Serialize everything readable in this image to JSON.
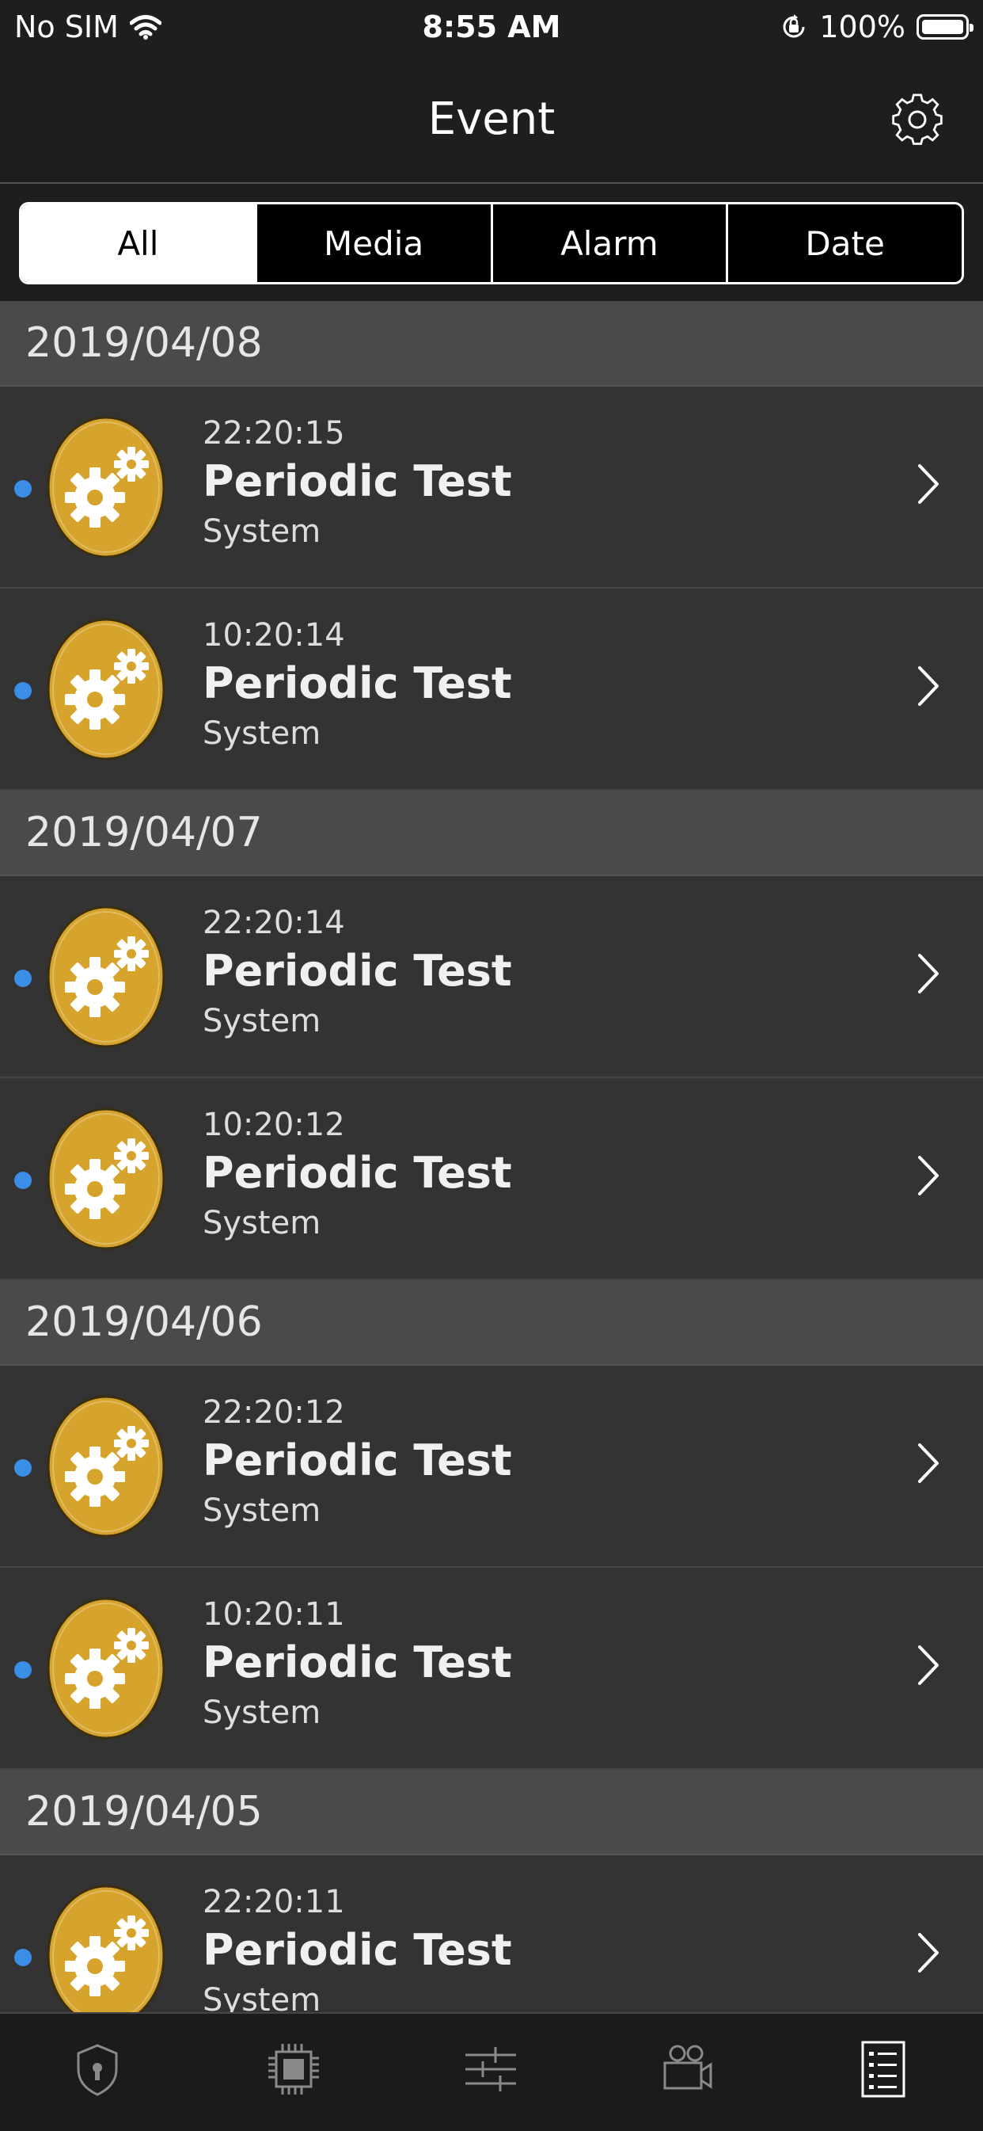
{
  "status_bar": {
    "carrier": "No SIM",
    "time": "8:55 AM",
    "battery": "100%"
  },
  "nav": {
    "title": "Event"
  },
  "filter_tabs": [
    {
      "label": "All",
      "active": true
    },
    {
      "label": "Media",
      "active": false
    },
    {
      "label": "Alarm",
      "active": false
    },
    {
      "label": "Date",
      "active": false
    }
  ],
  "sections": [
    {
      "date": "2019/04/08",
      "events": [
        {
          "time": "22:20:15",
          "title": "Periodic Test",
          "source": "System"
        },
        {
          "time": "10:20:14",
          "title": "Periodic Test",
          "source": "System"
        }
      ]
    },
    {
      "date": "2019/04/07",
      "events": [
        {
          "time": "22:20:14",
          "title": "Periodic Test",
          "source": "System"
        },
        {
          "time": "10:20:12",
          "title": "Periodic Test",
          "source": "System"
        }
      ]
    },
    {
      "date": "2019/04/06",
      "events": [
        {
          "time": "22:20:12",
          "title": "Periodic Test",
          "source": "System"
        },
        {
          "time": "10:20:11",
          "title": "Periodic Test",
          "source": "System"
        }
      ]
    },
    {
      "date": "2019/04/05",
      "events": [
        {
          "time": "22:20:11",
          "title": "Periodic Test",
          "source": "System"
        }
      ]
    }
  ],
  "tab_bar": [
    {
      "icon": "shield-lock-icon",
      "active": false
    },
    {
      "icon": "chip-icon",
      "active": false
    },
    {
      "icon": "sliders-icon",
      "active": false
    },
    {
      "icon": "video-camera-icon",
      "active": false
    },
    {
      "icon": "event-list-icon",
      "active": true
    }
  ],
  "colors": {
    "accent_gold": "#d6a42c",
    "unread_dot": "#3a8ee6",
    "background": "#333333",
    "section_header": "#4a4a4a"
  }
}
